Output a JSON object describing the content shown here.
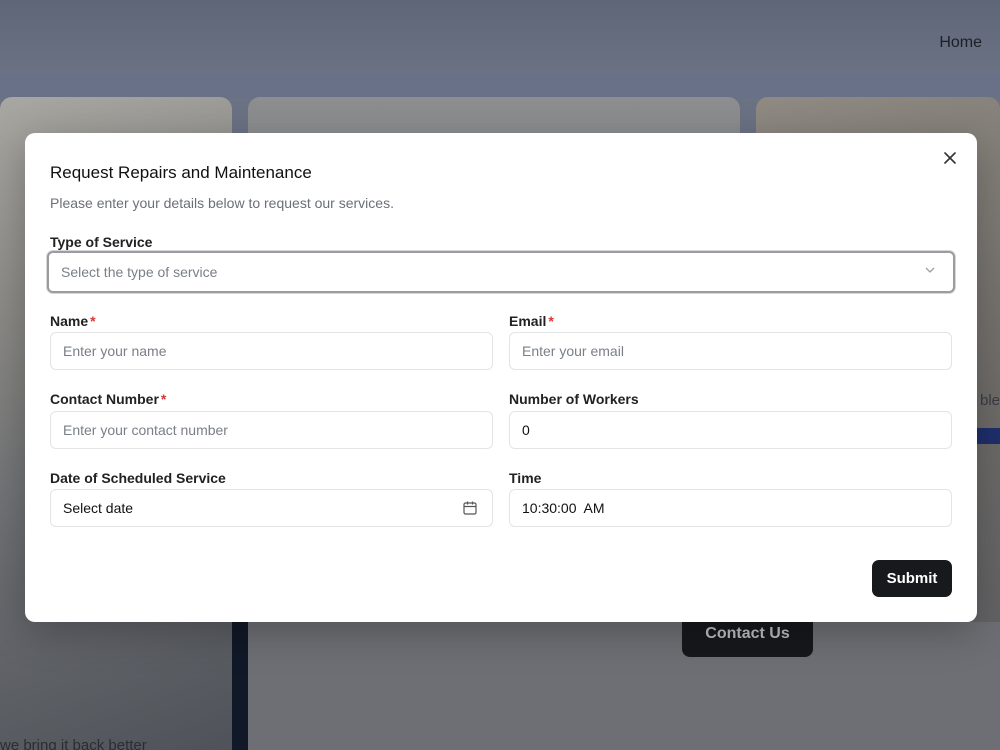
{
  "nav": {
    "home_label": "Home"
  },
  "background": {
    "contact_button_label": "Contact Us",
    "bottom_text": "we bring it back better",
    "side_text": "ble"
  },
  "modal": {
    "title": "Request Repairs and Maintenance",
    "subtitle": "Please enter your details below to request our services.",
    "close_icon": "close-icon",
    "service_type": {
      "label": "Type of Service",
      "placeholder": "Select the type of service"
    },
    "name": {
      "label": "Name",
      "required_mark": "*",
      "placeholder": "Enter your name"
    },
    "email": {
      "label": "Email",
      "required_mark": "*",
      "placeholder": "Enter your email"
    },
    "contact_number": {
      "label": "Contact Number",
      "required_mark": "*",
      "placeholder": "Enter your contact number"
    },
    "workers": {
      "label": "Number of Workers",
      "value": "0"
    },
    "date": {
      "label": "Date of Scheduled Service",
      "value": "Select date"
    },
    "time": {
      "label": "Time",
      "value": "10:30:00  AM"
    },
    "submit_label": "Submit"
  }
}
